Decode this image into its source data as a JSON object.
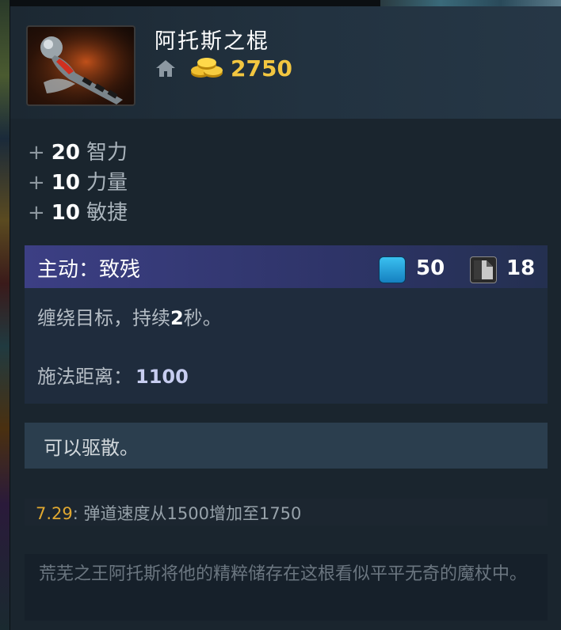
{
  "item": {
    "name": "阿托斯之棍",
    "cost": "2750",
    "icons": {
      "shop": "home-icon",
      "gold": "gold-coins-icon"
    }
  },
  "stats": [
    {
      "plus": "+",
      "value": "20",
      "name": "智力"
    },
    {
      "plus": "+",
      "value": "10",
      "name": "力量"
    },
    {
      "plus": "+",
      "value": "10",
      "name": "敏捷"
    }
  ],
  "active": {
    "title": "主动：致残",
    "mana_cost": "50",
    "cooldown": "18",
    "description_prefix": "缠绕目标，持续",
    "description_duration": "2",
    "description_suffix": "秒。",
    "range_label": "施法距离：",
    "range_value": "1100",
    "icons": {
      "mana": "mana-icon",
      "cooldown": "cooldown-icon"
    }
  },
  "dispel_note": "可以驱散。",
  "patch": {
    "version": "7.29",
    "note": ": 弹道速度从1500增加至1750"
  },
  "lore": "荒芜之王阿托斯将他的精粹储存在这根看似平平无奇的魔杖中。",
  "colors": {
    "gold": "#f2c640",
    "active_header": "#3c3f84",
    "mana": "#2aa8e0",
    "patch_version": "#e0a830"
  }
}
